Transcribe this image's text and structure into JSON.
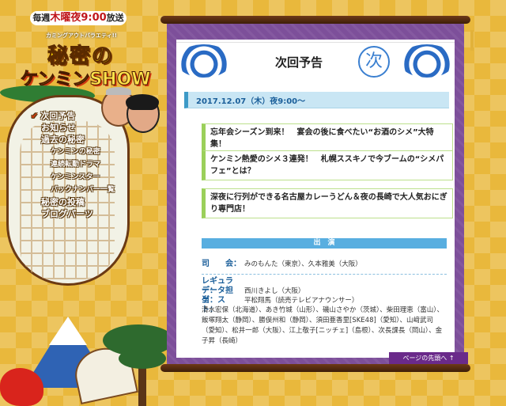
{
  "airtime": {
    "prefix": "毎週",
    "day": "木曜",
    "time": "夜9:00",
    "suffix": "放送"
  },
  "logo": {
    "subtitle": "カミングアウトバラエティ!!",
    "line1": "秘密の",
    "line2": "ケンミンSHOW"
  },
  "nav": [
    {
      "label": "次回予告",
      "active": true,
      "sub": false
    },
    {
      "label": "お知らせ",
      "sub": false
    },
    {
      "label": "過去の秘密",
      "sub": false
    },
    {
      "label": "ケンミンの秘密",
      "sub": true
    },
    {
      "label": "連続転勤ドラマ",
      "sub": true
    },
    {
      "label": "ケンミンスター",
      "sub": true
    },
    {
      "label": "バックナンバー一覧",
      "sub": true
    },
    {
      "label": "秘密の投稿",
      "sub": false
    },
    {
      "label": "ブログパーツ",
      "sub": false
    }
  ],
  "main": {
    "title": "次回予告",
    "badge": "次",
    "date": "2017.12.07（木）夜9:00～",
    "topics": [
      "忘年会シーズン到来！　宴会の後に食べたい“お酒のシメ”大特集！",
      "ケンミン熱愛のシメ３連発！　札幌ススキノで今ブームの“シメパフェ”とは？",
      "深夜に行列ができる名古屋カレーうどん＆夜の長崎で大人気おにぎり専門店！"
    ],
    "cast_heading": "出　演",
    "host_label": "司　　会：",
    "host_value": "みのもんた（東京）、久本雅美（大阪）",
    "regular_label": "レギュラー：",
    "regular_value": "西川きよし（大阪）",
    "data_label": "データ担当：",
    "data_value": "平松翔馬（読売テレビアナウンサー）",
    "guest_label": "ゲ　ス　ト：",
    "guests": "清水宏保（北海道）、あき竹城（山形）、磯山さやか（茨城）、柴田理恵（富山）、飯塚翔太（静岡）、勝俣州和（静岡）、須田亜香里[SKE48]（愛知）、山﨑武司（愛知）、松井一郎（大阪）、江上敬子[ニッチェ]（島根）、次長課長（岡山）、金子昇（長崎）"
  },
  "pagetop": "ページの先頭へ ↑"
}
